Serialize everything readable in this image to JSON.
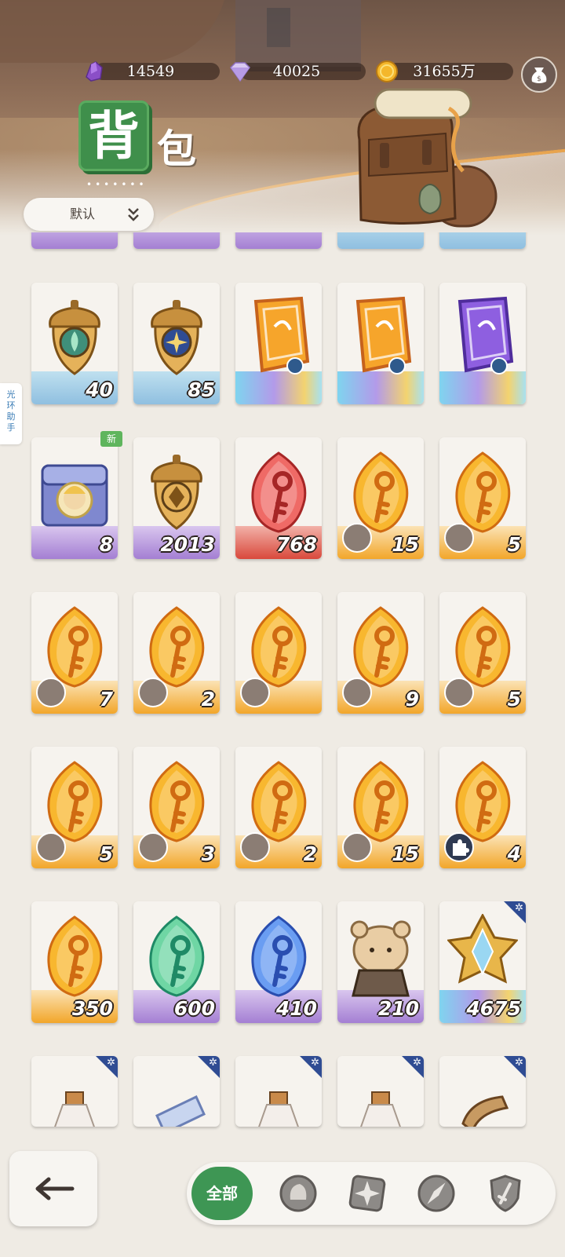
{
  "currencies": [
    {
      "name": "purple-crystal-icon",
      "value": "14549"
    },
    {
      "name": "diamond-icon",
      "value": "40025"
    },
    {
      "name": "gold-coin-icon",
      "value": "31655万"
    }
  ],
  "title": {
    "char1": "背",
    "char2": "包",
    "dots": "•••••••"
  },
  "sort": {
    "label": "默认"
  },
  "helper": {
    "label": "光环助手"
  },
  "items": [
    {
      "art": "acorn-emblem-green",
      "count": "40",
      "base": "blue"
    },
    {
      "art": "acorn-emblem-star",
      "count": "85",
      "base": "blue"
    },
    {
      "art": "orange-ticket-snowflake",
      "count": "",
      "base": "rainbow"
    },
    {
      "art": "orange-ticket-anchor",
      "count": "",
      "base": "rainbow"
    },
    {
      "art": "purple-ticket-anchor",
      "count": "",
      "base": "rainbow"
    },
    {
      "art": "treasure-chest",
      "count": "8",
      "base": "purple",
      "new": "新"
    },
    {
      "art": "acorn-emblem-diamond",
      "count": "2013",
      "base": "purple"
    },
    {
      "art": "red-key-gem",
      "count": "768",
      "base": "red"
    },
    {
      "art": "gold-key-gem",
      "count": "15",
      "base": "gold",
      "avatar": true
    },
    {
      "art": "gold-key-gem",
      "count": "5",
      "base": "gold",
      "avatar": true
    },
    {
      "art": "gold-key-gem",
      "count": "7",
      "base": "gold",
      "avatar": true
    },
    {
      "art": "gold-key-gem",
      "count": "2",
      "base": "gold",
      "avatar": true
    },
    {
      "art": "gold-key-gem",
      "count": "",
      "base": "gold",
      "avatar": true
    },
    {
      "art": "gold-key-gem",
      "count": "9",
      "base": "gold",
      "avatar": true
    },
    {
      "art": "gold-key-gem",
      "count": "5",
      "base": "gold",
      "avatar": true
    },
    {
      "art": "gold-key-gem",
      "count": "5",
      "base": "gold",
      "avatar": true
    },
    {
      "art": "gold-key-gem",
      "count": "3",
      "base": "gold",
      "avatar": true
    },
    {
      "art": "gold-key-gem",
      "count": "2",
      "base": "gold",
      "avatar": true
    },
    {
      "art": "gold-key-gem",
      "count": "15",
      "base": "gold",
      "avatar": true
    },
    {
      "art": "gold-key-gem",
      "count": "4",
      "base": "gold",
      "puzzle": true
    },
    {
      "art": "gold-key-gem",
      "count": "350",
      "base": "gold"
    },
    {
      "art": "green-key-gem",
      "count": "600",
      "base": "purple"
    },
    {
      "art": "blue-key-gem",
      "count": "410",
      "base": "purple"
    },
    {
      "art": "hamster-plush",
      "count": "210",
      "base": "purple"
    },
    {
      "art": "star-crest",
      "count": "4675",
      "base": "rainbow",
      "corner": true
    },
    {
      "art": "potion-bottle",
      "count": "",
      "base": "none",
      "corner": true
    },
    {
      "art": "blue-scroll",
      "count": "",
      "base": "none",
      "corner": true
    },
    {
      "art": "potion-bottle",
      "count": "",
      "base": "none",
      "corner": true
    },
    {
      "art": "potion-bottle",
      "count": "",
      "base": "none",
      "corner": true
    },
    {
      "art": "wood-frame",
      "count": "",
      "base": "none",
      "corner": true
    }
  ],
  "tabs": {
    "all_label": "全部"
  },
  "colors": {
    "accent_green": "#3e9654",
    "gold": "#f2a62a",
    "panel": "#efebe4"
  }
}
